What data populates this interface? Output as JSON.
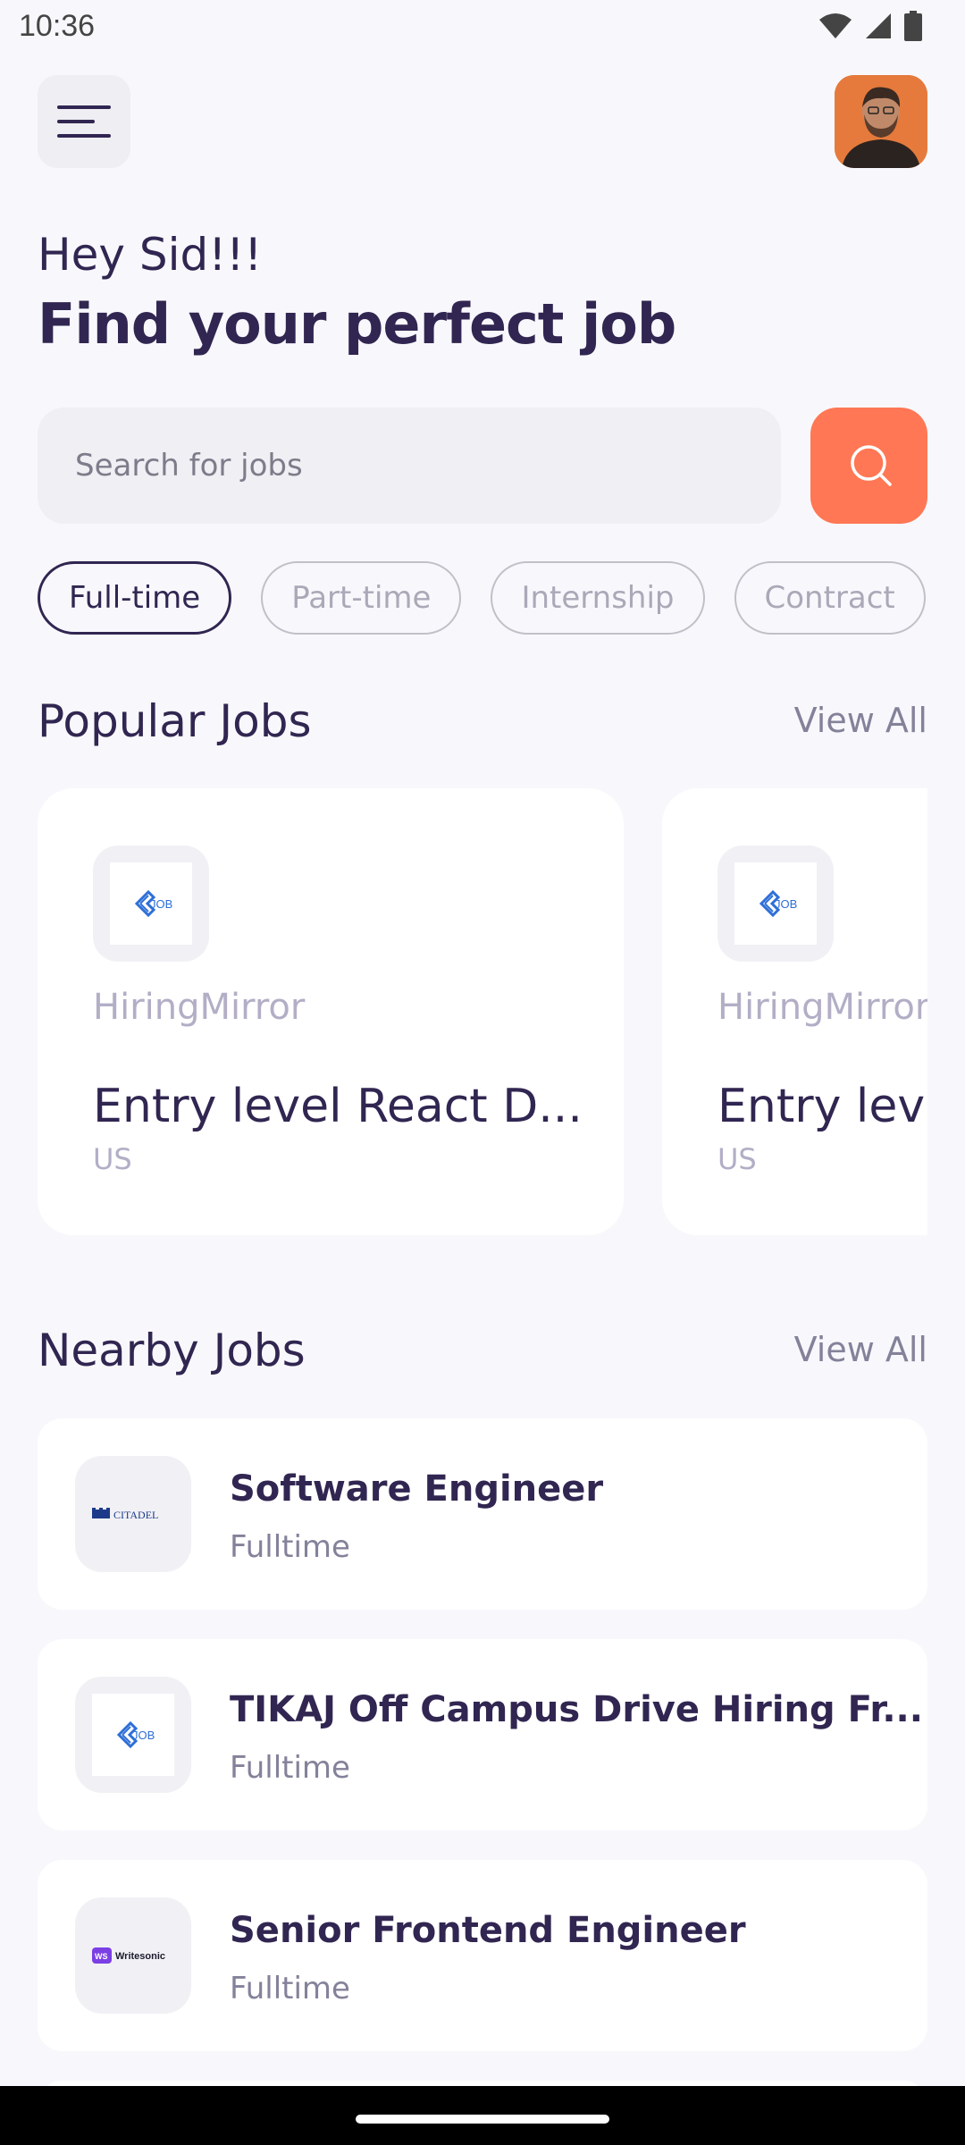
{
  "status": {
    "time": "10:36"
  },
  "header": {
    "greeting": "Hey Sid!!!",
    "headline": "Find your perfect job"
  },
  "search": {
    "placeholder": "Search for jobs",
    "value": ""
  },
  "tabs": [
    {
      "label": "Full-time",
      "active": true
    },
    {
      "label": "Part-time",
      "active": false
    },
    {
      "label": "Internship",
      "active": false
    },
    {
      "label": "Contract",
      "active": false
    }
  ],
  "popular": {
    "title": "Popular Jobs",
    "view_all": "View All",
    "cards": [
      {
        "company": "HiringMirror",
        "title": "Entry level React D...",
        "location": "US",
        "logo": "JOB"
      },
      {
        "company": "HiringMirror",
        "title": "Entry level React D...",
        "location": "US",
        "logo": "JOB"
      }
    ]
  },
  "nearby": {
    "title": "Nearby Jobs",
    "view_all": "View All",
    "items": [
      {
        "title": "Software Engineer",
        "type": "Fulltime",
        "logo": "CITADEL"
      },
      {
        "title": "TIKAJ Off Campus Drive Hiring Fr...",
        "type": "Fulltime",
        "logo": "JOB"
      },
      {
        "title": "Senior Frontend Engineer",
        "type": "Fulltime",
        "logo": "Writesonic"
      }
    ]
  },
  "colors": {
    "primary": "#312651",
    "accent": "#FF7754",
    "background": "#F8F8FC",
    "gray": "#83829A"
  }
}
